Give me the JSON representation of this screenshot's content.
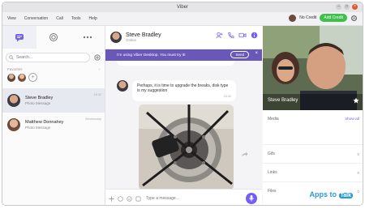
{
  "window": {
    "title": "Viber",
    "min": "–",
    "max": "□",
    "close": "×"
  },
  "menu": {
    "items": [
      "View",
      "Conversation",
      "Call",
      "Tools",
      "Help"
    ],
    "credit": "No Credit",
    "add_credit": "Add Credit"
  },
  "search": {
    "placeholder": "Search..."
  },
  "favorites": {
    "label": "Favorites",
    "more": "›"
  },
  "chats": [
    {
      "name": "Steve Bradley",
      "sub": "Photo Message",
      "date": "18:32"
    },
    {
      "name": "Matthew Donnahey",
      "sub": "Photo Message",
      "date": "Wednesday"
    }
  ],
  "header": {
    "name": "Steve Bradley",
    "status": "Online"
  },
  "banner": {
    "text": "I'm using Viber Desktop. You must try it!",
    "send": "Send",
    "close": "×"
  },
  "message": {
    "text": "Perhaps, it is time to upgrade the breaks, disk type is my suggestion",
    "time": "18:32"
  },
  "compose": {
    "placeholder": "Type a message..."
  },
  "profile": {
    "name": "Steve Bradley"
  },
  "info": {
    "media_label": "Media",
    "show_all": "show all",
    "gifs_label": "Gifs",
    "gifs_count": "0",
    "links_label": "Links",
    "links_count": "0",
    "files_label": "Files",
    "files_count": "0"
  },
  "watermark": {
    "part1": "Apps to",
    "part2": "Talk"
  },
  "colors": {
    "accent": "#7360f2",
    "banner": "#6a58b8",
    "green": "#3fc04b"
  }
}
